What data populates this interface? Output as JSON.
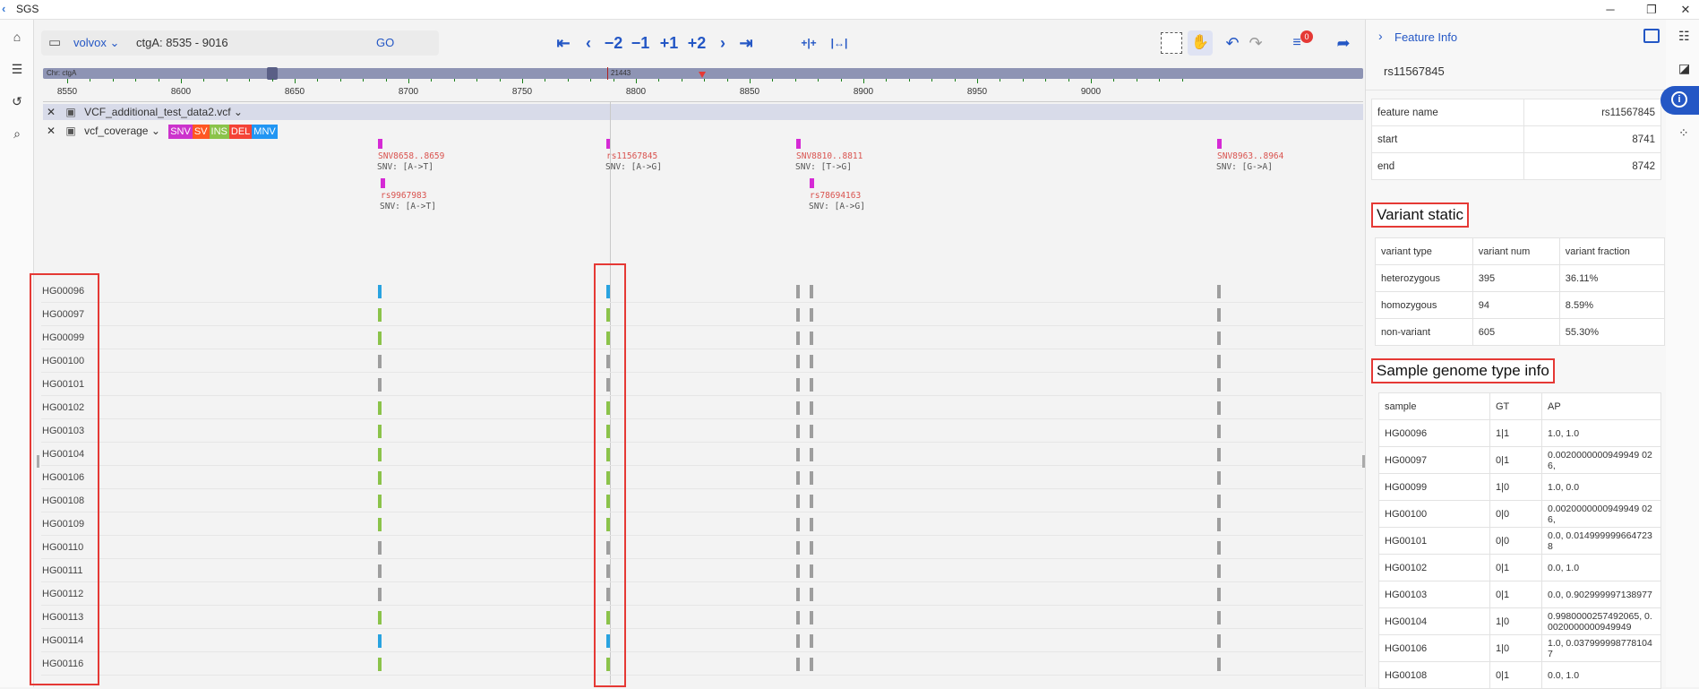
{
  "window": {
    "title": "SGS"
  },
  "toolbar": {
    "genome": "volvox",
    "location": "ctgA: 8535 - 9016",
    "go": "GO",
    "nav": [
      "⇤",
      "‹",
      "−2",
      "−1",
      "+1",
      "+2",
      "›",
      "⇥",
      "+|+",
      "|↔|"
    ],
    "badge": "0"
  },
  "overview": {
    "chr_label": "Chr: ctgA",
    "pos_label": "21443"
  },
  "ruler": {
    "ticks": [
      "8550",
      "8600",
      "8650",
      "8700",
      "8750",
      "8800",
      "8850",
      "8900",
      "8950",
      "9000"
    ]
  },
  "tracks": {
    "track1": "VCF_additional_test_data2.vcf",
    "track2": "vcf_coverage",
    "legend": [
      {
        "label": "SNV",
        "color": "#cc33cc"
      },
      {
        "label": "SV",
        "color": "#ff5722"
      },
      {
        "label": "INS",
        "color": "#8bc34a"
      },
      {
        "label": "DEL",
        "color": "#f44336"
      },
      {
        "label": "MNV",
        "color": "#2196f3"
      }
    ]
  },
  "variants": [
    {
      "name": "SNV8658..8659",
      "desc": "SNV: [A->T]"
    },
    {
      "name": "rs9967983",
      "desc": "SNV: [A->T]"
    },
    {
      "name": "rs11567845",
      "desc": "SNV: [A->G]"
    },
    {
      "name": "SNV8810..8811",
      "desc": "SNV: [T->G]"
    },
    {
      "name": "rs78694163",
      "desc": "SNV: [A->G]"
    },
    {
      "name": "SNV8963..8964",
      "desc": "SNV: [G->A]"
    }
  ],
  "samples": [
    "HG00096",
    "HG00097",
    "HG00099",
    "HG00100",
    "HG00101",
    "HG00102",
    "HG00103",
    "HG00104",
    "HG00106",
    "HG00108",
    "HG00109",
    "HG00110",
    "HG00111",
    "HG00112",
    "HG00113",
    "HG00114",
    "HG00116"
  ],
  "genotype_colors": {
    "het": "#8bc34a",
    "hom": "#29a3e0",
    "ref": "#9e9e9e"
  },
  "panel": {
    "title": "Feature Info",
    "feature_id": "rs11567845",
    "fields": [
      {
        "key": "feature name",
        "value": "rs11567845"
      },
      {
        "key": "start",
        "value": "8741"
      },
      {
        "key": "end",
        "value": "8742"
      }
    ],
    "variant_static_title": "Variant static",
    "variant_static_headers": [
      "variant type",
      "variant num",
      "variant fraction"
    ],
    "variant_static_rows": [
      [
        "heterozygous",
        "395",
        "36.11%"
      ],
      [
        "homozygous",
        "94",
        "8.59%"
      ],
      [
        "non-variant",
        "605",
        "55.30%"
      ]
    ],
    "sample_title": "Sample genome type info",
    "sample_headers": [
      "sample",
      "GT",
      "AP"
    ],
    "sample_rows": [
      [
        "HG00096",
        "1|1",
        "1.0, 1.0"
      ],
      [
        "HG00097",
        "0|1",
        "0.0020000000949949 026,"
      ],
      [
        "HG00099",
        "1|0",
        "1.0, 0.0"
      ],
      [
        "HG00100",
        "0|0",
        "0.0020000000949949 026,"
      ],
      [
        "HG00101",
        "0|0",
        "0.0, 0.0149999996647238"
      ],
      [
        "HG00102",
        "0|1",
        "0.0, 1.0"
      ],
      [
        "HG00103",
        "0|1",
        "0.0, 0.902999997138977"
      ],
      [
        "HG00104",
        "1|0",
        "0.9980000257492065, 0.0020000000949949"
      ],
      [
        "HG00106",
        "1|0",
        "1.0, 0.0379999987781047"
      ],
      [
        "HG00108",
        "0|1",
        "0.0, 1.0"
      ]
    ]
  }
}
